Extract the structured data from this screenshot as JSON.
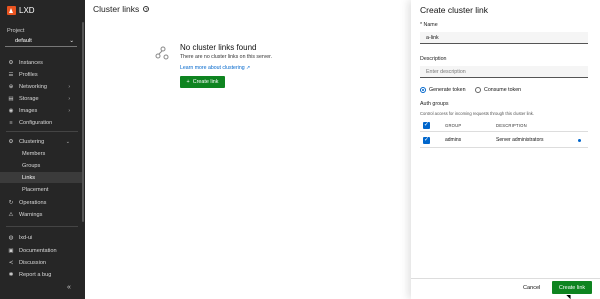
{
  "app": {
    "name": "LXD"
  },
  "sidebar": {
    "project_label": "Project",
    "project_value": "default",
    "items": [
      {
        "label": "Instances",
        "icon": "instances-icon"
      },
      {
        "label": "Profiles",
        "icon": "profiles-icon"
      },
      {
        "label": "Networking",
        "icon": "networking-icon"
      },
      {
        "label": "Storage",
        "icon": "storage-icon"
      },
      {
        "label": "Images",
        "icon": "images-icon"
      },
      {
        "label": "Configuration",
        "icon": "configuration-icon"
      },
      {
        "label": "Clustering",
        "icon": "clustering-icon"
      },
      {
        "label": "Members"
      },
      {
        "label": "Groups"
      },
      {
        "label": "Links"
      },
      {
        "label": "Placement"
      },
      {
        "label": "Operations",
        "icon": "operations-icon"
      },
      {
        "label": "Warnings",
        "icon": "warnings-icon"
      }
    ],
    "bottom": [
      {
        "label": "lxd-ui",
        "icon": "lxd-ui-icon"
      },
      {
        "label": "Documentation",
        "icon": "documentation-icon"
      },
      {
        "label": "Discussion",
        "icon": "discussion-icon"
      },
      {
        "label": "Report a bug",
        "icon": "bug-icon"
      }
    ],
    "collapse_glyph": "«"
  },
  "main": {
    "title": "Cluster links",
    "empty_title": "No cluster links found",
    "empty_desc": "There are no cluster links on this server.",
    "learn_more": "Learn more about clustering ↗",
    "create_button": "Create link"
  },
  "panel": {
    "title": "Create cluster link",
    "name_label": "* Name",
    "name_value": "a-link",
    "description_label": "Description",
    "description_placeholder": "Enter description",
    "radio_generate": "Generate token",
    "radio_consume": "Consume token",
    "auth_label": "Auth groups",
    "auth_sub": "Control access for incoming requests through this cluster link.",
    "table_headers": [
      "GROUP",
      "DESCRIPTION"
    ],
    "table_rows": [
      {
        "group": "admins",
        "description": "Server administrators"
      }
    ],
    "cancel": "Cancel",
    "submit": "Create link"
  },
  "colors": {
    "accent_green": "#0e8420",
    "link_blue": "#0066cc",
    "sidebar_bg": "#262626",
    "brand_orange": "#e95420"
  }
}
